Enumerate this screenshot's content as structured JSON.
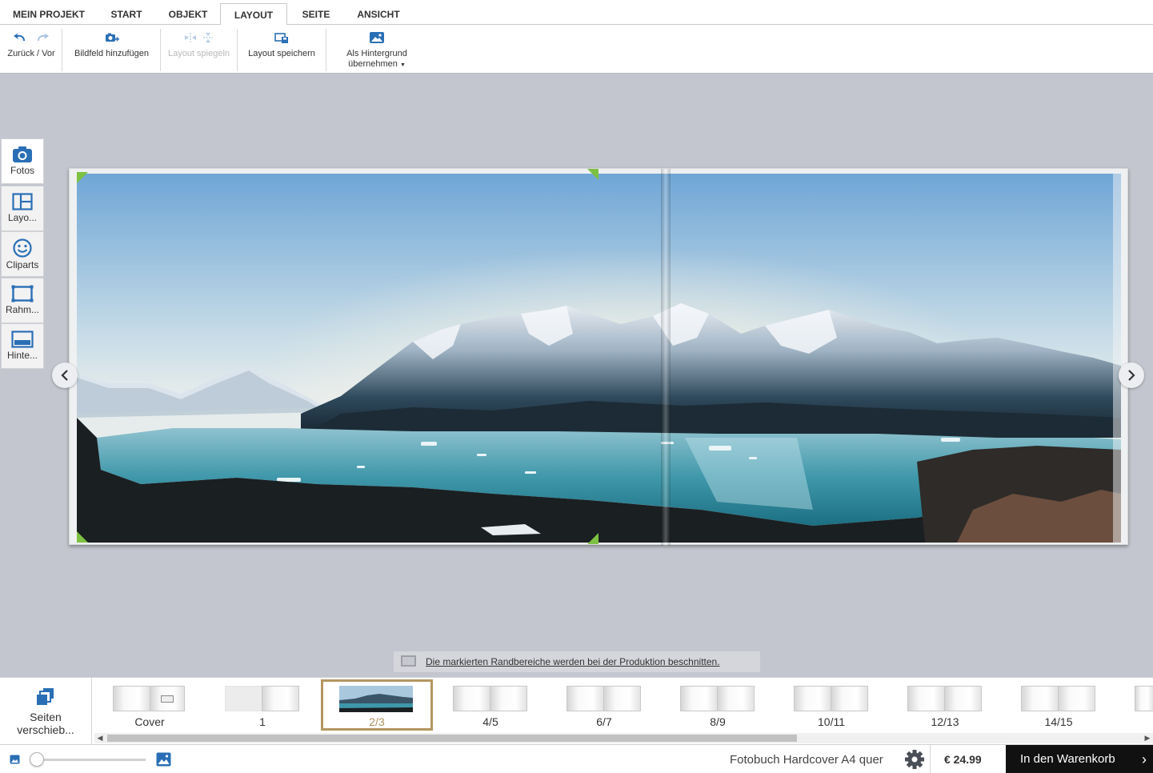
{
  "tabs": [
    {
      "label": "MEIN PROJEKT"
    },
    {
      "label": "START"
    },
    {
      "label": "OBJEKT"
    },
    {
      "label": "LAYOUT",
      "active": true
    },
    {
      "label": "SEITE"
    },
    {
      "label": "ANSICHT"
    }
  ],
  "ribbon": {
    "undo_redo": {
      "label": "Zurück / Vor",
      "icon": "undo-redo-icon"
    },
    "add_image_field": {
      "label": "Bildfeld hinzufügen",
      "icon": "add-photo-icon"
    },
    "mirror_layout": {
      "label": "Layout spiegeln",
      "icon": "mirror-icon",
      "disabled": true
    },
    "save_layout": {
      "label": "Layout speichern",
      "icon": "save-layout-icon"
    },
    "as_background": {
      "label_line1": "Als Hintergrund",
      "label_line2": "übernehmen",
      "icon": "background-image-icon"
    }
  },
  "sidebar": {
    "items": [
      {
        "label": "Fotos",
        "icon": "camera-icon",
        "active": true
      },
      {
        "label": "Layo...",
        "icon": "layout-icon"
      },
      {
        "label": "Cliparts",
        "icon": "smiley-icon"
      },
      {
        "label": "Rahm...",
        "icon": "frame-icon"
      },
      {
        "label": "Hinte...",
        "icon": "background-icon"
      }
    ]
  },
  "hint": {
    "text": "Die markierten Randbereiche werden bei der Produktion beschnitten."
  },
  "page_strip": {
    "move_label_line1": "Seiten",
    "move_label_line2": "verschieb...",
    "thumbnails": [
      {
        "label": "Cover"
      },
      {
        "label": "1"
      },
      {
        "label": "2/3",
        "selected": true
      },
      {
        "label": "4/5"
      },
      {
        "label": "6/7"
      },
      {
        "label": "8/9"
      },
      {
        "label": "10/11"
      },
      {
        "label": "12/13"
      },
      {
        "label": "14/15"
      }
    ]
  },
  "status": {
    "product": "Fotobuch Hardcover A4 quer",
    "price": "€ 24.99",
    "cart_label": "In den Warenkorb"
  },
  "colors": {
    "accent_blue": "#2a6fb5",
    "selected_thumb": "#b39660",
    "crop_marker": "#7dc142",
    "canvas_bg": "#c3c6ce"
  }
}
